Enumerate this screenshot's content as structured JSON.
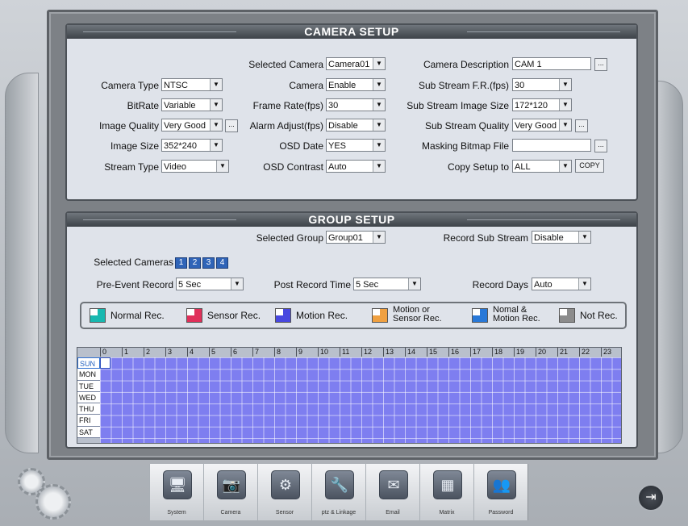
{
  "camera_setup": {
    "title": "CAMERA SETUP",
    "selected_camera": {
      "label": "Selected Camera",
      "value": "Camera01"
    },
    "camera_description": {
      "label": "Camera Description",
      "value": "CAM 1"
    },
    "camera_type": {
      "label": "Camera Type",
      "value": "NTSC"
    },
    "camera": {
      "label": "Camera",
      "value": "Enable"
    },
    "sub_stream_fr": {
      "label": "Sub Stream F.R.(fps)",
      "value": "30"
    },
    "bitrate": {
      "label": "BitRate",
      "value": "Variable"
    },
    "frame_rate": {
      "label": "Frame Rate(fps)",
      "value": "30"
    },
    "sub_stream_image_size": {
      "label": "Sub Stream Image Size",
      "value": "172*120"
    },
    "image_quality": {
      "label": "Image Quality",
      "value": "Very Good"
    },
    "alarm_adjust": {
      "label": "Alarm Adjust(fps)",
      "value": "Disable"
    },
    "sub_stream_quality": {
      "label": "Sub Stream  Quality",
      "value": "Very Good"
    },
    "image_size": {
      "label": "Image Size",
      "value": "352*240"
    },
    "osd_date": {
      "label": "OSD Date",
      "value": "YES"
    },
    "masking_bitmap": {
      "label": "Masking Bitmap File",
      "value": ""
    },
    "stream_type": {
      "label": "Stream Type",
      "value": "Video"
    },
    "osd_contrast": {
      "label": "OSD Contrast",
      "value": "Auto"
    },
    "copy_setup": {
      "label": "Copy Setup to",
      "value": "ALL",
      "button": "COPY"
    },
    "ellipsis": "..."
  },
  "group_setup": {
    "title": "GROUP SETUP",
    "selected_group": {
      "label": "Selected Group",
      "value": "Group01"
    },
    "record_sub_stream": {
      "label": "Record Sub Stream",
      "value": "Disable"
    },
    "selected_cameras": {
      "label": "Selected Cameras",
      "values": [
        "1",
        "2",
        "3",
        "4"
      ]
    },
    "pre_event": {
      "label": "Pre-Event Record",
      "value": "5 Sec"
    },
    "post_record": {
      "label": "Post Record Time",
      "value": "5 Sec"
    },
    "record_days": {
      "label": "Record Days",
      "value": "Auto"
    },
    "legend": [
      {
        "label": "Normal Rec.",
        "color": "#18b8b0"
      },
      {
        "label": "Sensor Rec.",
        "color": "#e0305a"
      },
      {
        "label": "Motion Rec.",
        "color": "#4848e0"
      },
      {
        "label": "Motion or",
        "label2": "Sensor Rec.",
        "color": "#f0a040"
      },
      {
        "label": "Nomal &",
        "label2": "Motion Rec.",
        "color": "#2878d8"
      },
      {
        "label": "Not Rec.",
        "color": "#8c8c8c"
      }
    ],
    "hours": [
      "0",
      "1",
      "2",
      "3",
      "4",
      "5",
      "6",
      "7",
      "8",
      "9",
      "10",
      "11",
      "12",
      "13",
      "14",
      "15",
      "16",
      "17",
      "18",
      "19",
      "20",
      "21",
      "22",
      "23"
    ],
    "days": [
      "SUN",
      "MON",
      "TUE",
      "WED",
      "THU",
      "FRI",
      "SAT"
    ],
    "schedule_color": "#7e7ef0"
  },
  "tabs": [
    {
      "label": "System",
      "icon": "computer-icon"
    },
    {
      "label": "Camera",
      "icon": "camera-icon"
    },
    {
      "label": "Sensor",
      "icon": "sensor-icon"
    },
    {
      "label": "ptz & Linkage",
      "icon": "ptz-icon"
    },
    {
      "label": "Email",
      "icon": "email-icon"
    },
    {
      "label": "Matrix",
      "icon": "matrix-icon"
    },
    {
      "label": "Password",
      "icon": "password-icon"
    }
  ]
}
